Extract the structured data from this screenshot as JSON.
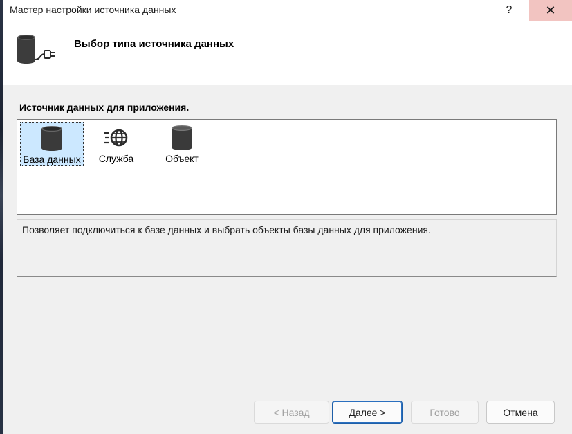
{
  "window": {
    "title": "Мастер настройки источника данных",
    "help_glyph": "?",
    "close_glyph": "✕"
  },
  "header": {
    "title": "Выбор типа источника данных",
    "icon": "database-plug-icon"
  },
  "section_label": "Источник данных для приложения.",
  "data_sources": [
    {
      "label": "База данных",
      "icon": "database-icon",
      "selected": true
    },
    {
      "label": "Служба",
      "icon": "service-globe-icon",
      "selected": false
    },
    {
      "label": "Объект",
      "icon": "object-cylinder-icon",
      "selected": false
    }
  ],
  "description": "Позволяет подключиться к базе данных и выбрать объекты базы данных для приложения.",
  "buttons": {
    "back": "< Назад",
    "next": "Далее >",
    "finish": "Готово",
    "cancel": "Отмена"
  },
  "colors": {
    "selection": "#cce8ff",
    "primary_border": "#1e5fa8",
    "close_hover": "#f2c4c1"
  }
}
